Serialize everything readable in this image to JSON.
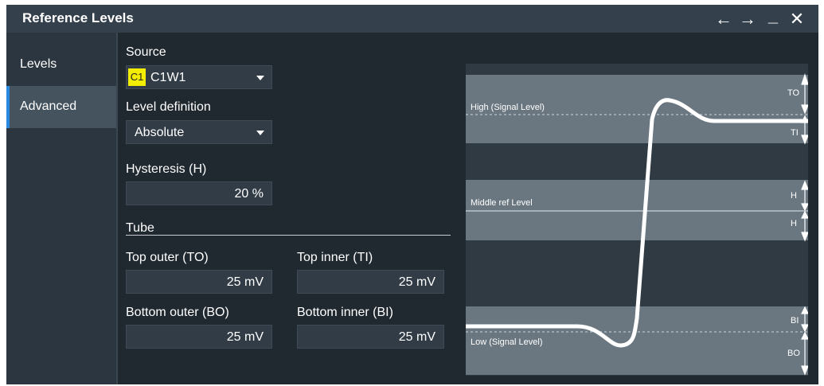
{
  "window": {
    "title": "Reference Levels",
    "controls": {
      "back": "←",
      "forward": "→",
      "minimize": "_",
      "close": "✕"
    }
  },
  "sidebar": {
    "items": [
      {
        "label": "Levels",
        "active": false
      },
      {
        "label": "Advanced",
        "active": true
      }
    ]
  },
  "form": {
    "source": {
      "label": "Source",
      "badge": "C1",
      "value": "C1W1"
    },
    "level_definition": {
      "label": "Level definition",
      "value": "Absolute"
    },
    "hysteresis": {
      "label": "Hysteresis (H)",
      "value": "20 %"
    },
    "tube": {
      "label": "Tube"
    },
    "top_outer": {
      "label": "Top outer (TO)",
      "value": "25 mV"
    },
    "top_inner": {
      "label": "Top inner (TI)",
      "value": "25 mV"
    },
    "bottom_outer": {
      "label": "Bottom outer (BO)",
      "value": "25 mV"
    },
    "bottom_inner": {
      "label": "Bottom inner (BI)",
      "value": "25 mV"
    }
  },
  "diagram": {
    "high_label": "High (Signal Level)",
    "middle_label": "Middle ref Level",
    "low_label": "Low (Signal Level)",
    "to": "TO",
    "ti": "TI",
    "h_upper": "H",
    "h_lower": "H",
    "bi": "BI",
    "bo": "BO"
  },
  "colors": {
    "background": "#202830",
    "titlebar": "#34404b",
    "sidebar": "#2c3640",
    "accent": "#2b8ae0",
    "c1_badge": "#f3ee00",
    "diagram_band": "#6a7780"
  }
}
